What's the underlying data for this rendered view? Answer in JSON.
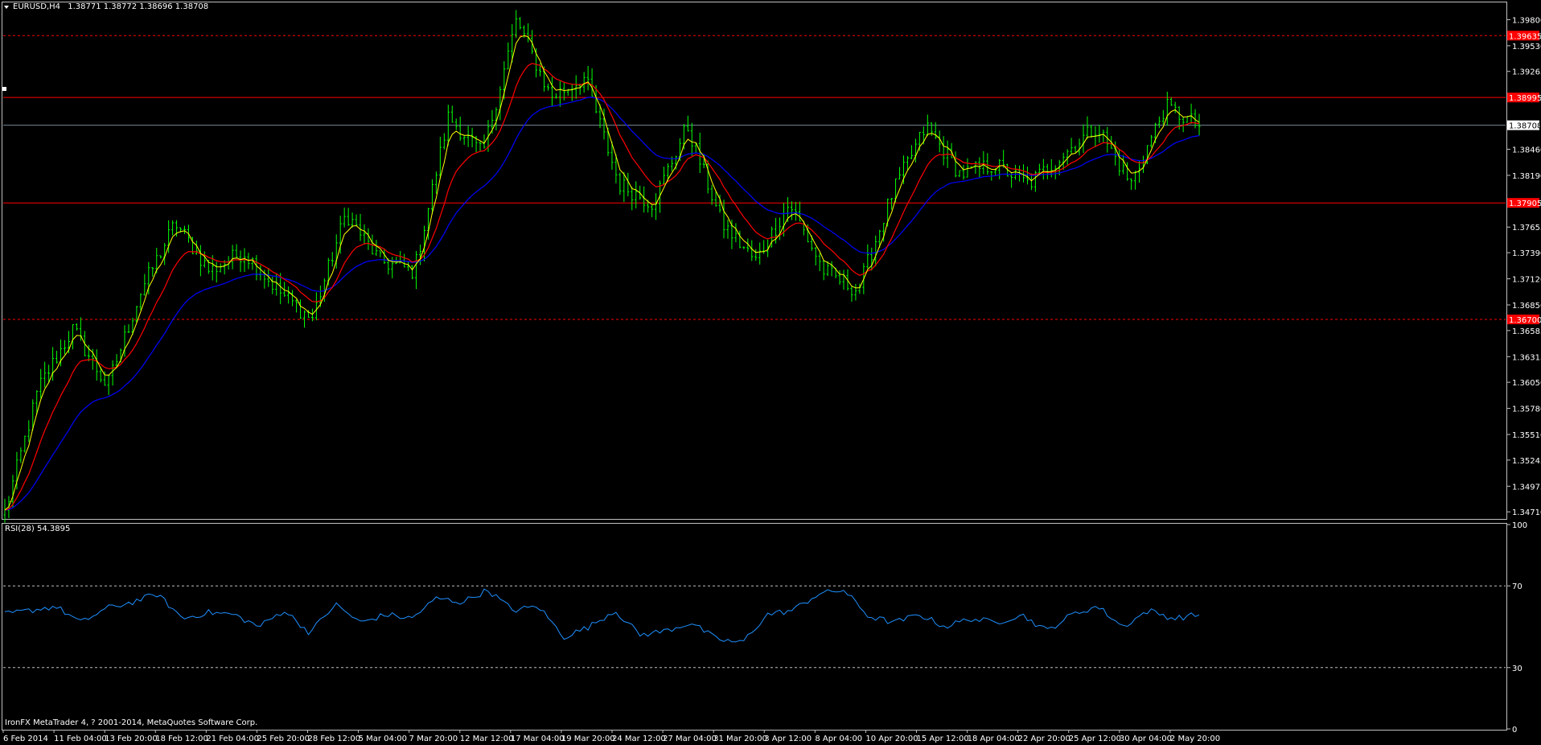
{
  "header": {
    "symbol_timeframe": "EURUSD,H4",
    "ohlc": "1.38771 1.38772 1.38696 1.38708"
  },
  "indicator_label": "RSI(28) 54.3895",
  "copyright": "IronFX MetaTrader 4, ? 2001-2014, MetaQuotes Software Corp.",
  "colors": {
    "background": "#000000",
    "frame": "#c0c0c0",
    "bars": "#00ff00",
    "ma_fast": "#ffff00",
    "ma_mid": "#ff0000",
    "ma_slow": "#0000ff",
    "level_line": "#ff0000",
    "bid_line": "#778899",
    "rsi_line": "#1e90ff",
    "rsi_levels": "#c0c0c0",
    "tag_bg": "#ff0000"
  },
  "chart_data": [
    {
      "type": "candlestick",
      "symbol": "EURUSD",
      "timeframe": "H4",
      "ylim": [
        1.34645,
        1.3997
      ],
      "y_ticks": [
        "1.39800",
        "1.39530",
        "1.39265",
        "1.38995",
        "1.38708",
        "1.38460",
        "1.38190",
        "1.37925",
        "1.37655",
        "1.37390",
        "1.37120",
        "1.36850",
        "1.36585",
        "1.36315",
        "1.36050",
        "1.35780",
        "1.35510",
        "1.35245",
        "1.34975",
        "1.34710"
      ],
      "x_ticks": [
        "6 Feb 2014",
        "11 Feb 04:00",
        "13 Feb 20:00",
        "18 Feb 12:00",
        "21 Feb 04:00",
        "25 Feb 20:00",
        "28 Feb 12:00",
        "5 Mar 04:00",
        "7 Mar 20:00",
        "12 Mar 12:00",
        "17 Mar 04:00",
        "19 Mar 20:00",
        "24 Mar 12:00",
        "27 Mar 04:00",
        "31 Mar 20:00",
        "3 Apr 12:00",
        "8 Apr 04:00",
        "10 Apr 20:00",
        "15 Apr 12:00",
        "18 Apr 04:00",
        "22 Apr 20:00",
        "25 Apr 12:00",
        "30 Apr 04:00",
        "2 May 20:00"
      ],
      "price_path_closes": [
        1.347,
        1.36,
        1.366,
        1.36,
        1.37,
        1.377,
        1.372,
        1.374,
        1.37,
        1.367,
        1.378,
        1.373,
        1.372,
        1.388,
        1.384,
        1.398,
        1.39,
        1.392,
        1.381,
        1.379,
        1.387,
        1.377,
        1.373,
        1.379,
        1.372,
        1.37,
        1.38,
        1.387,
        1.382,
        1.383,
        1.381,
        1.384,
        1.387,
        1.381,
        1.389,
        1.387
      ],
      "horizontal_levels": [
        {
          "price": 1.39635,
          "tag": "1.39635"
        },
        {
          "price": 1.38995,
          "tag": "1.38995"
        },
        {
          "price": 1.37905,
          "tag": "1.37905"
        },
        {
          "price": 1.367,
          "tag": "1.36700"
        }
      ],
      "bid_price": 1.38708,
      "bid_tag": "1.38708"
    },
    {
      "type": "line",
      "name": "RSI(28)",
      "ylim": [
        0,
        100
      ],
      "y_ticks": [
        "100",
        "70",
        "30",
        "0"
      ],
      "levels": [
        70,
        30
      ],
      "rsi_path": [
        56,
        58,
        60,
        52,
        59,
        62,
        66,
        54,
        57,
        56,
        50,
        58,
        47,
        61,
        52,
        56,
        54,
        64,
        62,
        68,
        58,
        60,
        45,
        50,
        58,
        46,
        48,
        52,
        44,
        42,
        56,
        58,
        66,
        68,
        55,
        52,
        56,
        50,
        54,
        52,
        56,
        48,
        56,
        60,
        50,
        58,
        54,
        56
      ]
    }
  ]
}
